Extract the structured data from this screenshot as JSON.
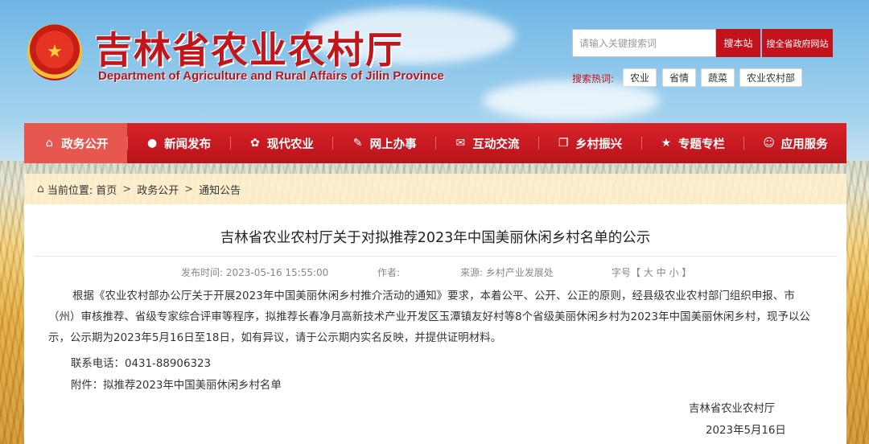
{
  "header": {
    "site_title": "吉林省农业农村厅",
    "site_subtitle": "Department of Agriculture and Rural Affairs of Jilin Province",
    "search": {
      "placeholder": "请输入关键搜索词",
      "search_site_label": "搜本站",
      "search_gov_label": "搜全省政府网站"
    },
    "hot_words": {
      "label": "搜索热词:",
      "tags": [
        "农业",
        "省情",
        "蔬菜",
        "农业农村部"
      ]
    }
  },
  "nav": {
    "items": [
      {
        "label": "政务公开",
        "icon": "house-icon"
      },
      {
        "label": "新闻发布",
        "icon": "chat-bubble-icon"
      },
      {
        "label": "现代农业",
        "icon": "sprout-icon"
      },
      {
        "label": "网上办事",
        "icon": "edit-icon"
      },
      {
        "label": "互动交流",
        "icon": "envelope-icon"
      },
      {
        "label": "乡村振兴",
        "icon": "copy-icon"
      },
      {
        "label": "专题专栏",
        "icon": "star-icon"
      },
      {
        "label": "应用服务",
        "icon": "user-icon"
      }
    ],
    "active": "政务公开"
  },
  "breadcrumb": {
    "prefix": "当前位置:",
    "items": [
      "首页",
      "政务公开",
      "通知公告"
    ],
    "separator": ">"
  },
  "article": {
    "title": "吉林省农业农村厅关于对拟推荐2023年中国美丽休闲乡村名单的公示",
    "meta": {
      "publish_time": "发布时间: 2023-05-16 15:55:00",
      "author": "作者:",
      "source": "来源: 乡村产业发展处",
      "font_size": "字号【 大 中 小 】"
    },
    "paragraph": "根据《农业农村部办公厅关于开展2023年中国美丽休闲乡村推介活动的通知》要求，本着公平、公开、公正的原则，经县级农业农村部门组织申报、市（州）审核推荐、省级专家综合评审等程序，拟推荐长春净月高新技术产业开发区玉潭镇友好村等8个省级美丽休闲乡村为2023年中国美丽休闲乡村，现予以公示，公示期为2023年5月16日至18日，如有异议，请于公示期内实名反映，并提供证明材料。",
    "phone": "联系电话：0431-88906323",
    "attachment_label": "附件：",
    "attachment_link": "拟推荐2023年中国美丽休闲乡村名单",
    "signature_org": "吉林省农业农村厅",
    "signature_date": "2023年5月16日"
  },
  "colors": {
    "brand_red": "#c3121b",
    "nav_active": "#e8574f"
  }
}
